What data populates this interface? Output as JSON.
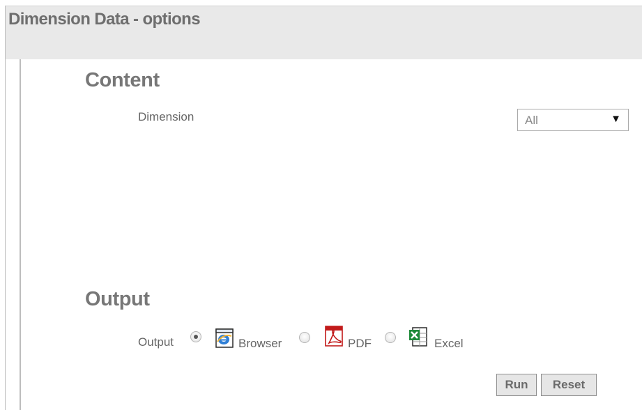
{
  "header": {
    "title": "Dimension Data - options"
  },
  "content_section": {
    "heading": "Content",
    "dimension_label": "Dimension",
    "dimension_select": {
      "selected": "All",
      "arrow": "▼"
    }
  },
  "output_section": {
    "heading": "Output",
    "output_label": "Output",
    "options": [
      {
        "label": "Browser",
        "icon": "browser-icon",
        "checked": true
      },
      {
        "label": "PDF",
        "icon": "pdf-icon",
        "checked": false
      },
      {
        "label": "Excel",
        "icon": "excel-icon",
        "checked": false
      }
    ]
  },
  "actions": {
    "run_label": "Run",
    "reset_label": "Reset"
  },
  "colors": {
    "title_bar_bg": "#e9e9e9",
    "heading_text": "#777777",
    "button_bg": "#e6e6e6"
  }
}
